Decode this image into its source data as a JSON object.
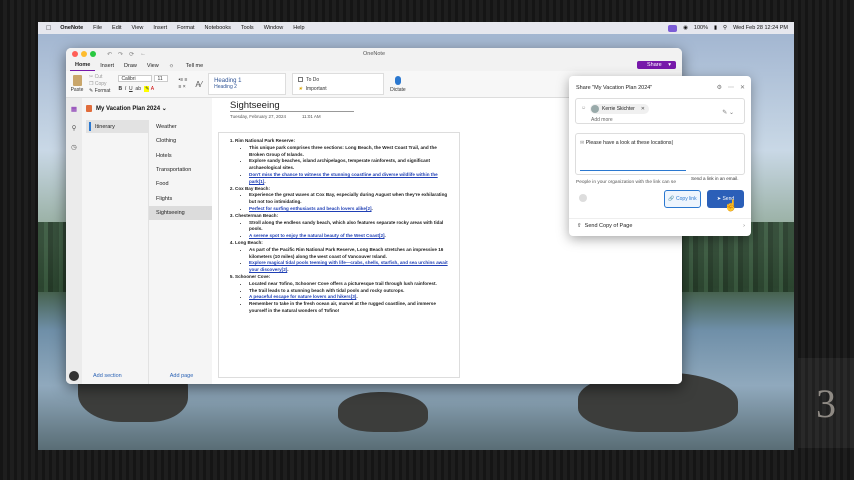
{
  "menubar": {
    "app": "OneNote",
    "items": [
      "File",
      "Edit",
      "View",
      "Insert",
      "Format",
      "Notebooks",
      "Tools",
      "Window",
      "Help"
    ],
    "battery": "100%",
    "clock": "Wed Feb 28 12:24 PM"
  },
  "window": {
    "title": "OneNote"
  },
  "tabs": [
    "Home",
    "Insert",
    "Draw",
    "View"
  ],
  "tell_me": "Tell me",
  "share_label": "Share",
  "ribbon": {
    "paste": "Paste",
    "cut": "Cut",
    "copy": "Copy",
    "format": "Format",
    "font": "Calibri",
    "size": "11",
    "heading1": "Heading 1",
    "heading2": "Heading 2",
    "todo": "To Do",
    "important": "Important",
    "dictate": "Dictate"
  },
  "notebook": {
    "name": "My Vacation Plan 2024"
  },
  "sections": [
    {
      "label": "Itinerary"
    }
  ],
  "pages": [
    {
      "label": "Weather"
    },
    {
      "label": "Clothing"
    },
    {
      "label": "Hotels"
    },
    {
      "label": "Transportation"
    },
    {
      "label": "Food"
    },
    {
      "label": "Flights"
    },
    {
      "label": "Sightseeing"
    }
  ],
  "footer": {
    "add_section": "Add section",
    "add_page": "Add page"
  },
  "page": {
    "title": "Sightseeing",
    "date": "Tuesday, February 27, 2024",
    "time": "11:01 AM"
  },
  "content": {
    "items": [
      {
        "heading": "Rim National Park Reserve:",
        "bullets": [
          {
            "parts": [
              {
                "t": "This unique park comprises three sections: "
              },
              {
                "t": "Long Beach",
                "b": true
              },
              {
                "t": ", the "
              },
              {
                "t": "West Coast Trail",
                "b": true
              },
              {
                "t": ", and the "
              },
              {
                "t": "Broken Group of Islands",
                "b": true
              },
              {
                "t": "."
              }
            ]
          },
          {
            "parts": [
              {
                "t": "Explore sandy beaches, island archipelagos, temperate rainforests, and significant archaeological sites."
              }
            ]
          },
          {
            "parts": [
              {
                "t": "Don't miss the chance to witness the stunning coastline and diverse wildlife within the park[1]",
                "l": true
              },
              {
                "t": "."
              }
            ]
          }
        ]
      },
      {
        "heading": "Cox Bay Beach:",
        "bullets": [
          {
            "parts": [
              {
                "t": "Experience the great waves at Cox Bay, especially during August when they're exhilarating but not too intimidating."
              }
            ]
          },
          {
            "parts": [
              {
                "t": "Perfect for surfing enthusiasts and beach lovers alike[2]",
                "l": true
              },
              {
                "t": "."
              }
            ]
          }
        ]
      },
      {
        "heading": "Chesterman Beach:",
        "bullets": [
          {
            "parts": [
              {
                "t": "Stroll along the endless sandy beach, which also features separate rocky areas with tidal pools."
              }
            ]
          },
          {
            "parts": [
              {
                "t": "A serene spot to enjoy the natural beauty of the West Coast[2]",
                "l": true
              },
              {
                "t": "."
              }
            ]
          }
        ]
      },
      {
        "heading": "Long Beach:",
        "bullets": [
          {
            "parts": [
              {
                "t": "As part of the Pacific Rim National Park Reserve, Long Beach stretches an impressive "
              },
              {
                "t": "16 kilometers (10 miles)",
                "b": true
              },
              {
                "t": " along the west coast of Vancouver Island."
              }
            ]
          },
          {
            "parts": [
              {
                "t": "Explore magical tidal pools teeming with life—crabs, shells, starfish, and sea urchins await your discovery[2]",
                "l": true
              },
              {
                "t": "."
              }
            ]
          }
        ]
      },
      {
        "heading": "Schooner Cove:",
        "bullets": [
          {
            "parts": [
              {
                "t": "Located near Tofino, Schooner Cove offers a picturesque trail through lush rainforest."
              }
            ]
          },
          {
            "parts": [
              {
                "t": "The trail leads to a stunning beach with tidal pools and rocky outcrops."
              }
            ]
          },
          {
            "parts": [
              {
                "t": "A peaceful escape for nature lovers and hikers[3]",
                "l": true
              },
              {
                "t": "."
              }
            ]
          },
          {
            "parts": [
              {
                "t": "Remember to take in the fresh ocean air, marvel at the rugged coastline, and immerse yourself in the natural wonders of Tofino!"
              }
            ]
          }
        ]
      }
    ]
  },
  "share_panel": {
    "title": "Share \"My Vacation Plan 2024\"",
    "recipient": "Kerrie Skichter",
    "add_more": "Add more",
    "message": "Please have a look at these locations",
    "info": "People in your organization with the link can se",
    "tooltip": "Send a link in an email.",
    "copy_link": "Copy link",
    "send": "Send",
    "send_copy": "Send Copy of Page"
  },
  "colors": {
    "accent": "#7719aa",
    "link": "#1f3fb5",
    "send": "#2b5fb8"
  }
}
